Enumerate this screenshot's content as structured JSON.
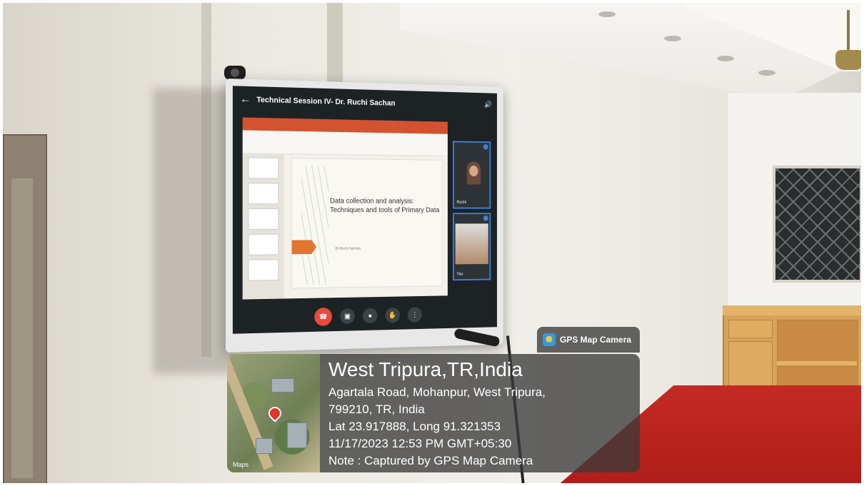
{
  "screen": {
    "meeting_title": "Technical Session IV- Dr. Ruchi Sachan",
    "slide_title": "Data collection and analysis: Techniques and tools of Primary Data",
    "slide_author": "Dr Ruchi Sachan",
    "tile_top_name": "Ruchi",
    "tile_bottom_name": "You"
  },
  "gps": {
    "badge": "GPS Map Camera",
    "city": "West Tripura,TR,India",
    "address_1": "Agartala Road, Mohanpur, West Tripura,",
    "address_2": "799210, TR, India",
    "coords": "Lat 23.917888, Long 91.321353",
    "datetime": "11/17/2023 12:53 PM GMT+05:30",
    "note": "Note : Captured by GPS Map Camera",
    "map_label": "Maps"
  }
}
